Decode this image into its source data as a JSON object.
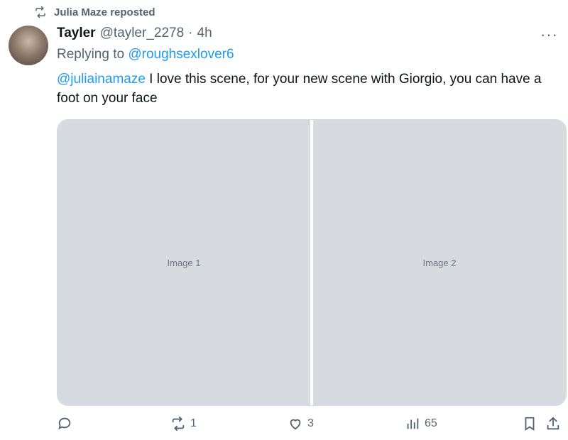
{
  "repost": {
    "label": "Julia Maze reposted",
    "icon": "repost-icon"
  },
  "tweet": {
    "name": "Tayler",
    "handle": "@tayler_2278",
    "dot": "·",
    "time": "4h",
    "replying_prefix": "Replying to ",
    "replying_handle": "@roughsexlover6",
    "mention": "@juliainamaze",
    "text": " I love this scene, for your new scene with Giorgio, you can have a foot on your face",
    "more_label": "···"
  },
  "media": {
    "tiles": [
      "Image 1",
      "Image 2"
    ]
  },
  "actions": {
    "reply": {
      "icon": "reply-icon",
      "count": ""
    },
    "repost": {
      "icon": "repost-icon",
      "count": "1"
    },
    "like": {
      "icon": "heart-icon",
      "count": "3"
    },
    "views": {
      "icon": "views-icon",
      "count": "65"
    },
    "bookmark": {
      "icon": "bookmark-icon"
    },
    "share": {
      "icon": "share-icon"
    }
  },
  "colors": {
    "muted": "#536471",
    "link": "#1d9bf0",
    "text": "#0f1419"
  }
}
